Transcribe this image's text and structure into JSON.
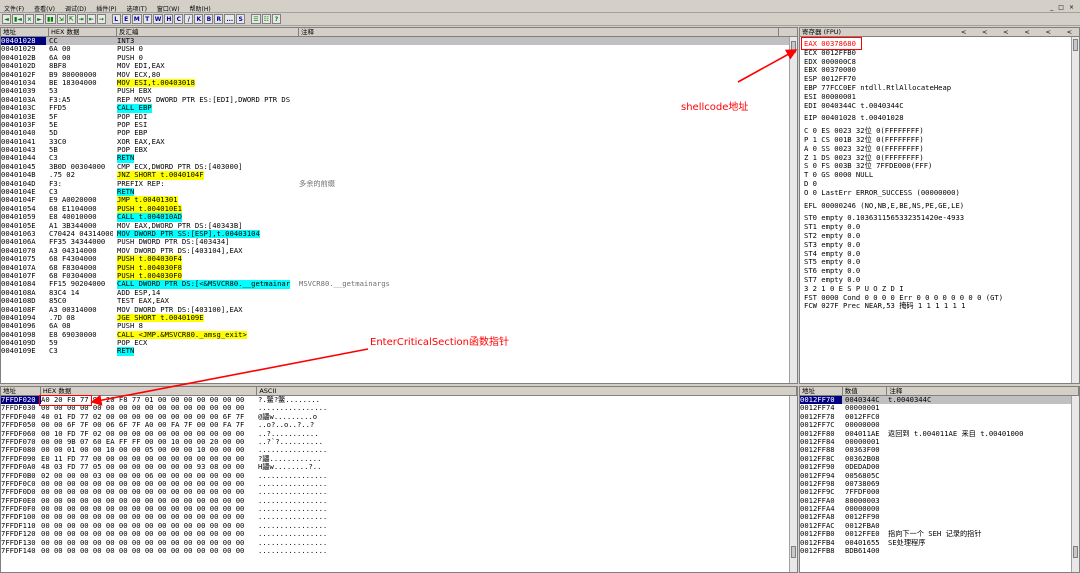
{
  "menu": {
    "items": [
      "文件(F)",
      "查看(V)",
      "调试(D)",
      "插件(P)",
      "选项(T)",
      "窗口(W)",
      "帮助(H)"
    ],
    "win_controls": [
      "_",
      "□",
      "×"
    ]
  },
  "toolbar": {
    "buttons": [
      "◄",
      "▮◄",
      "×",
      "►",
      "▮▮",
      "⇲",
      "⇱",
      "⇥",
      "⇤",
      "→",
      "L",
      "E",
      "M",
      "T",
      "W",
      "H",
      "C",
      "/",
      "K",
      "B",
      "R",
      "...",
      "S",
      "☰",
      "☷",
      "?"
    ]
  },
  "colors": {
    "annotation": "#ff0000",
    "selection": "#000080",
    "highlight_call": "#00ffff",
    "highlight_jump": "#ffff00"
  },
  "disasm": {
    "headers": [
      "地址",
      "HEX 数据",
      "反汇编",
      "注释"
    ],
    "rows": [
      {
        "a": "00401028",
        "h": "CC",
        "d": "INT3",
        "c": "",
        "sel": true
      },
      {
        "a": "00401029",
        "h": "6A 00",
        "d": "PUSH 0",
        "c": ""
      },
      {
        "a": "0040102B",
        "h": "6A 00",
        "d": "PUSH 0",
        "c": ""
      },
      {
        "a": "0040102D",
        "h": "8BF8",
        "d": "MOV EDI,EAX",
        "c": ""
      },
      {
        "a": "0040102F",
        "h": "B9 80000000",
        "d": "MOV ECX,80",
        "c": ""
      },
      {
        "a": "00401034",
        "h": "BE 18304000",
        "d": "MOV ESI,t.00403018",
        "c": "",
        "hl": "y"
      },
      {
        "a": "00401039",
        "h": "53",
        "d": "PUSH EBX",
        "c": ""
      },
      {
        "a": "0040103A",
        "h": "F3:A5",
        "d": "REP MOVS DWORD PTR ES:[EDI],DWORD PTR DS",
        "c": ""
      },
      {
        "a": "0040103C",
        "h": "FFD5",
        "d": "CALL EBP",
        "c": "",
        "hl": "c"
      },
      {
        "a": "0040103E",
        "h": "5F",
        "d": "POP EDI",
        "c": ""
      },
      {
        "a": "0040103F",
        "h": "5E",
        "d": "POP ESI",
        "c": ""
      },
      {
        "a": "00401040",
        "h": "5D",
        "d": "POP EBP",
        "c": ""
      },
      {
        "a": "00401041",
        "h": "33C0",
        "d": "XOR EAX,EAX",
        "c": ""
      },
      {
        "a": "00401043",
        "h": "5B",
        "d": "POP EBX",
        "c": ""
      },
      {
        "a": "00401044",
        "h": "C3",
        "d": "RETN",
        "c": "",
        "hl": "c"
      },
      {
        "a": "00401045",
        "h": "3B0D 00304000",
        "d": "CMP ECX,DWORD PTR DS:[403000]",
        "c": ""
      },
      {
        "a": "0040104B",
        "h": ".75 02",
        "d": "JNZ SHORT t.0040104F",
        "c": "",
        "hl": "y"
      },
      {
        "a": "0040104D",
        "h": "F3:",
        "d": "PREFIX REP:",
        "c": "多余的前缀"
      },
      {
        "a": "0040104E",
        "h": "C3",
        "d": "RETN",
        "c": "",
        "hl": "c"
      },
      {
        "a": "0040104F",
        "h": "E9 A0020000",
        "d": "JMP t.00401301",
        "c": "",
        "hl": "y"
      },
      {
        "a": "00401054",
        "h": "68 E1104000",
        "d": "PUSH t.004010E1",
        "c": "",
        "hl": "y"
      },
      {
        "a": "00401059",
        "h": "E8 40010000",
        "d": "CALL t.004010AD",
        "c": "",
        "hl": "c"
      },
      {
        "a": "0040105E",
        "h": "A1 3B344000",
        "d": "MOV EAX,DWORD PTR DS:[40343B]",
        "c": ""
      },
      {
        "a": "00401063",
        "h": "C70424 04314000",
        "d": "MOV DWORD PTR SS:[ESP],t.00403104",
        "c": "",
        "hl": "c"
      },
      {
        "a": "0040106A",
        "h": "FF35 34344000",
        "d": "PUSH DWORD PTR DS:[403434]",
        "c": ""
      },
      {
        "a": "00401070",
        "h": "A3 04314000",
        "d": "MOV DWORD PTR DS:[403104],EAX",
        "c": ""
      },
      {
        "a": "00401075",
        "h": "68 F4304000",
        "d": "PUSH t.004030F4",
        "c": "",
        "hl": "y"
      },
      {
        "a": "0040107A",
        "h": "68 F8304000",
        "d": "PUSH t.004030F8",
        "c": "",
        "hl": "y"
      },
      {
        "a": "0040107F",
        "h": "68 F0304000",
        "d": "PUSH t.004030F0",
        "c": "",
        "hl": "y"
      },
      {
        "a": "00401084",
        "h": "FF15 90204000",
        "d": "CALL DWORD PTR DS:[<&MSVCR80.__getmainar",
        "c": "MSVCR80.__getmainargs",
        "hl": "c"
      },
      {
        "a": "0040108A",
        "h": "83C4 14",
        "d": "ADD ESP,14",
        "c": ""
      },
      {
        "a": "0040108D",
        "h": "85C0",
        "d": "TEST EAX,EAX",
        "c": ""
      },
      {
        "a": "0040108F",
        "h": "A3 00314000",
        "d": "MOV DWORD PTR DS:[403100],EAX",
        "c": ""
      },
      {
        "a": "00401094",
        "h": ".7D 08",
        "d": "JGE SHORT t.0040109E",
        "c": "",
        "hl": "y"
      },
      {
        "a": "00401096",
        "h": "6A 08",
        "d": "PUSH 8",
        "c": ""
      },
      {
        "a": "00401098",
        "h": "E8 69030000",
        "d": "CALL <JMP.&MSVCR80._amsg_exit>",
        "c": "",
        "hl": "y"
      },
      {
        "a": "0040109D",
        "h": "59",
        "d": "POP ECX",
        "c": ""
      },
      {
        "a": "0040109E",
        "h": "C3",
        "d": "RETN",
        "c": "",
        "hl": "c"
      }
    ]
  },
  "registers": {
    "header": "寄存器 (FPU)",
    "nav": [
      "<",
      "<",
      "<",
      "<",
      "<",
      "<"
    ],
    "rows": [
      {
        "t": "EAX 00378680",
        "red": true
      },
      {
        "t": "ECX 0012FFB0"
      },
      {
        "t": "EDX 000000C8"
      },
      {
        "t": "EBX 00370000"
      },
      {
        "t": "ESP 0012FF70"
      },
      {
        "t": "EBP 77FCC0EF ntdll.RtlAllocateHeap"
      },
      {
        "t": "ESI 00000001"
      },
      {
        "t": "EDI 0040344C t.0040344C"
      },
      {
        "t": ""
      },
      {
        "t": "EIP 00401028 t.00401028"
      },
      {
        "t": ""
      },
      {
        "t": "C 0  ES 0023 32位 0(FFFFFFFF)"
      },
      {
        "t": "P 1  CS 001B 32位 0(FFFFFFFF)"
      },
      {
        "t": "A 0  SS 0023 32位 0(FFFFFFFF)"
      },
      {
        "t": "Z 1  DS 0023 32位 0(FFFFFFFF)"
      },
      {
        "t": "S 0  FS 003B 32位 7FFDE000(FFF)"
      },
      {
        "t": "T 0  GS 0000 NULL"
      },
      {
        "t": "D 0"
      },
      {
        "t": "O 0  LastErr ERROR_SUCCESS (00000000)"
      },
      {
        "t": ""
      },
      {
        "t": "EFL 00000246 (NO,NB,E,BE,NS,PE,GE,LE)"
      },
      {
        "t": ""
      },
      {
        "t": "ST0 empty 0.1036311565332351420e-4933"
      },
      {
        "t": "ST1 empty 0.0"
      },
      {
        "t": "ST2 empty 0.0"
      },
      {
        "t": "ST3 empty 0.0"
      },
      {
        "t": "ST4 empty 0.0"
      },
      {
        "t": "ST5 empty 0.0"
      },
      {
        "t": "ST6 empty 0.0"
      },
      {
        "t": "ST7 empty 0.0"
      },
      {
        "t": "               3 2 1 0      E S P U O Z D I"
      },
      {
        "t": "FST 0000  Cond 0 0 0 0  Err 0 0 0 0 0 0 0 0  (GT)"
      },
      {
        "t": "FCW 027F  Prec NEAR,53  掩码    1 1 1 1 1 1"
      }
    ]
  },
  "dump": {
    "headers": [
      "地址",
      "HEX 数据",
      "ASCII"
    ],
    "rows": [
      {
        "a": "7FFDF020",
        "h": "A0 20 F8 77 91 20 F8 77 01 00 00 00 00 00 00 00",
        "s": "?.鳖?鳖........",
        "sel": true
      },
      {
        "a": "7FFDF030",
        "h": "00 00 00 00 00 00 00 00 00 00 00 00 00 00 00 00",
        "s": "................"
      },
      {
        "a": "7FFDF040",
        "h": "40 01 FD 77 02 00 00 00 00 00 00 00 00 00 6F 7F",
        "s": "@鼺w.........o"
      },
      {
        "a": "7FFDF050",
        "h": "00 00 6F 7F 00 06 6F 7F A0 00 FA 7F 00 00 FA 7F",
        "s": "..o?..o..?..?"
      },
      {
        "a": "7FFDF060",
        "h": "00 10 FD 7F 02 00 00 00 00 00 00 00 00 00 00 00",
        "s": "..?..........."
      },
      {
        "a": "7FFDF070",
        "h": "00 00 9B 07 60 EA FF FF 00 00 10 00 00 20 00 00",
        "s": "..?`?.........."
      },
      {
        "a": "7FFDF080",
        "h": "00 00 01 00 00 10 00 00 05 00 00 00 10 00 00 00",
        "s": "................"
      },
      {
        "a": "7FFDF090",
        "h": "E0 11 FD 77 00 00 00 00 00 00 00 00 00 00 00 00",
        "s": "?鼺............"
      },
      {
        "a": "7FFDF0A0",
        "h": "48 03 FD 77 05 00 00 00 00 00 00 00 93 08 00 00",
        "s": "H鼺w........?.."
      },
      {
        "a": "7FFDF0B0",
        "h": "02 00 00 00 03 00 00 00 06 00 00 00 00 00 00 00",
        "s": "................"
      },
      {
        "a": "7FFDF0C0",
        "h": "00 00 00 00 00 00 00 00 00 00 00 00 00 00 00 00",
        "s": "................"
      },
      {
        "a": "7FFDF0D0",
        "h": "00 00 00 00 00 00 00 00 00 00 00 00 00 00 00 00",
        "s": "................"
      },
      {
        "a": "7FFDF0E0",
        "h": "00 00 00 00 00 00 00 00 00 00 00 00 00 00 00 00",
        "s": "................"
      },
      {
        "a": "7FFDF0F0",
        "h": "00 00 00 00 00 00 00 00 00 00 00 00 00 00 00 00",
        "s": "................"
      },
      {
        "a": "7FFDF100",
        "h": "00 00 00 00 00 00 00 00 00 00 00 00 00 00 00 00",
        "s": "................"
      },
      {
        "a": "7FFDF110",
        "h": "00 00 00 00 00 00 00 00 00 00 00 00 00 00 00 00",
        "s": "................"
      },
      {
        "a": "7FFDF120",
        "h": "00 00 00 00 00 00 00 00 00 00 00 00 00 00 00 00",
        "s": "................"
      },
      {
        "a": "7FFDF130",
        "h": "00 00 00 00 00 00 00 00 00 00 00 00 00 00 00 00",
        "s": "................"
      },
      {
        "a": "7FFDF140",
        "h": "00 00 00 00 00 00 00 00 00 00 00 00 00 00 00 00",
        "s": "................"
      }
    ]
  },
  "stack": {
    "headers": [
      "地址",
      "数值",
      "注释"
    ],
    "rows": [
      {
        "a": "0012FF70",
        "v": "0040344C",
        "c": "t.0040344C",
        "sel": true
      },
      {
        "a": "0012FF74",
        "v": "00000001",
        "c": ""
      },
      {
        "a": "0012FF78",
        "v": "0012FFC0",
        "c": ""
      },
      {
        "a": "0012FF7C",
        "v": "00000000",
        "c": ""
      },
      {
        "a": "0012FF80",
        "v": "004011AE",
        "c": "返回到 t.004011AE 来自 t.00401000"
      },
      {
        "a": "0012FF84",
        "v": "00000001",
        "c": ""
      },
      {
        "a": "0012FF88",
        "v": "00363F00",
        "c": ""
      },
      {
        "a": "0012FF8C",
        "v": "00362B08",
        "c": ""
      },
      {
        "a": "0012FF90",
        "v": "0DEDAD00",
        "c": ""
      },
      {
        "a": "0012FF94",
        "v": "0056805C",
        "c": ""
      },
      {
        "a": "0012FF98",
        "v": "00738069",
        "c": ""
      },
      {
        "a": "0012FF9C",
        "v": "7FFDF000",
        "c": ""
      },
      {
        "a": "0012FFA0",
        "v": "80000003",
        "c": ""
      },
      {
        "a": "0012FFA4",
        "v": "00000000",
        "c": ""
      },
      {
        "a": "0012FFA8",
        "v": "0012FF90",
        "c": ""
      },
      {
        "a": "0012FFAC",
        "v": "0012FBA0",
        "c": ""
      },
      {
        "a": "0012FFB0",
        "v": "0012FFE0",
        "c": "指向下一个 SEH 记录的指针"
      },
      {
        "a": "0012FFB4",
        "v": "00401655",
        "c": "SE处理程序"
      },
      {
        "a": "0012FFB8",
        "v": "BDB61400",
        "c": ""
      }
    ]
  },
  "annotations": {
    "shellcode": "shellcode地址",
    "critical": "EnterCriticalSection函数指针"
  }
}
